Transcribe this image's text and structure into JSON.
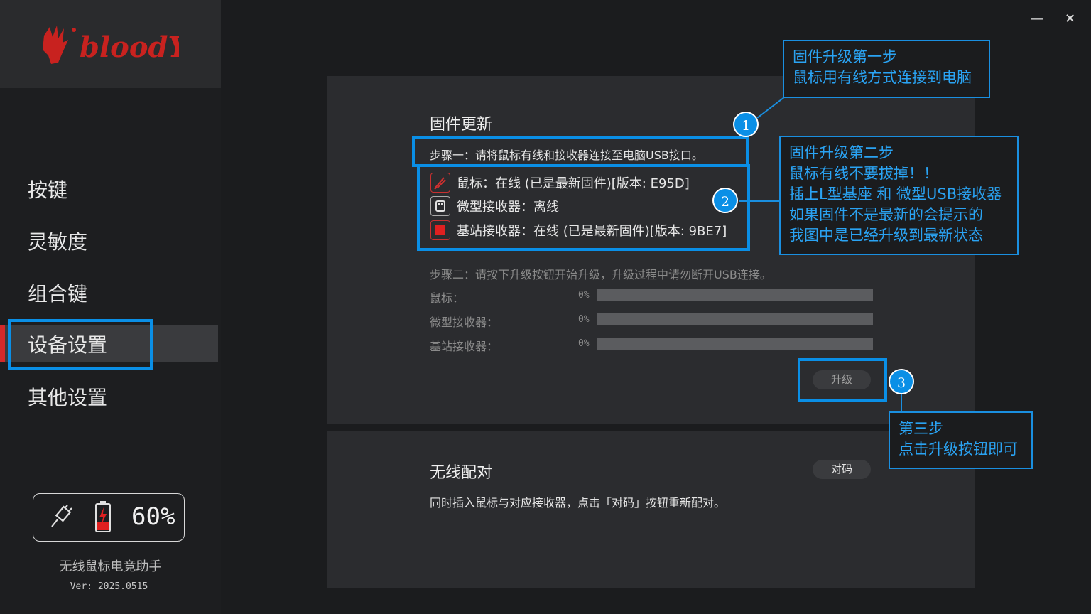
{
  "window": {
    "minimize_icon": "minimize-icon",
    "close_icon": "close-icon",
    "minimize": "—",
    "close": "✕"
  },
  "brand": {
    "logo_text": "bloody"
  },
  "sidebar": {
    "items": [
      {
        "label": "按键"
      },
      {
        "label": "灵敏度"
      },
      {
        "label": "组合键"
      },
      {
        "label": "设备设置",
        "active": true
      },
      {
        "label": "其他设置"
      }
    ],
    "battery_percent": "60%",
    "app_name": "无线鼠标电竞助手",
    "version": "Ver: 2025.0515"
  },
  "firmware": {
    "title": "固件更新",
    "step1": "步骤一：请将鼠标有线和接收器连接至电脑USB接口。",
    "devices": [
      {
        "text": "鼠标：在线 (已是最新固件)[版本: E95D]",
        "icon": "mouse-icon"
      },
      {
        "text": "微型接收器：离线",
        "icon": "receiver-icon"
      },
      {
        "text": "基站接收器：在线 (已是最新固件)[版本: 9BE7]",
        "icon": "base-station-icon"
      }
    ],
    "step2": "步骤二：请按下升级按钮开始升级，升级过程中请勿断开USB连接。",
    "progress": [
      {
        "label": "鼠标：",
        "pct": "0%"
      },
      {
        "label": "微型接收器：",
        "pct": "0%"
      },
      {
        "label": "基站接收器：",
        "pct": "0%"
      }
    ],
    "upgrade_button": "升级"
  },
  "pairing": {
    "title": "无线配对",
    "button": "对码",
    "description": "同时插入鼠标与对应接收器，点击「对码」按钮重新配对。"
  },
  "annotations": {
    "callout1": [
      "固件升级第一步",
      "鼠标用有线方式连接到电脑"
    ],
    "callout2": [
      "固件升级第二步",
      "鼠标有线不要拔掉！！",
      "插上L型基座 和 微型USB接收器",
      "如果固件不是最新的会提示的",
      "我图中是已经升级到最新状态"
    ],
    "callout3": [
      "第三步",
      "点击升级按钮即可"
    ],
    "markers": [
      "1",
      "2",
      "3"
    ]
  },
  "colors": {
    "accent": "#0a8fe6",
    "active_red": "#d42a2a",
    "panel": "#2b2c2f"
  }
}
